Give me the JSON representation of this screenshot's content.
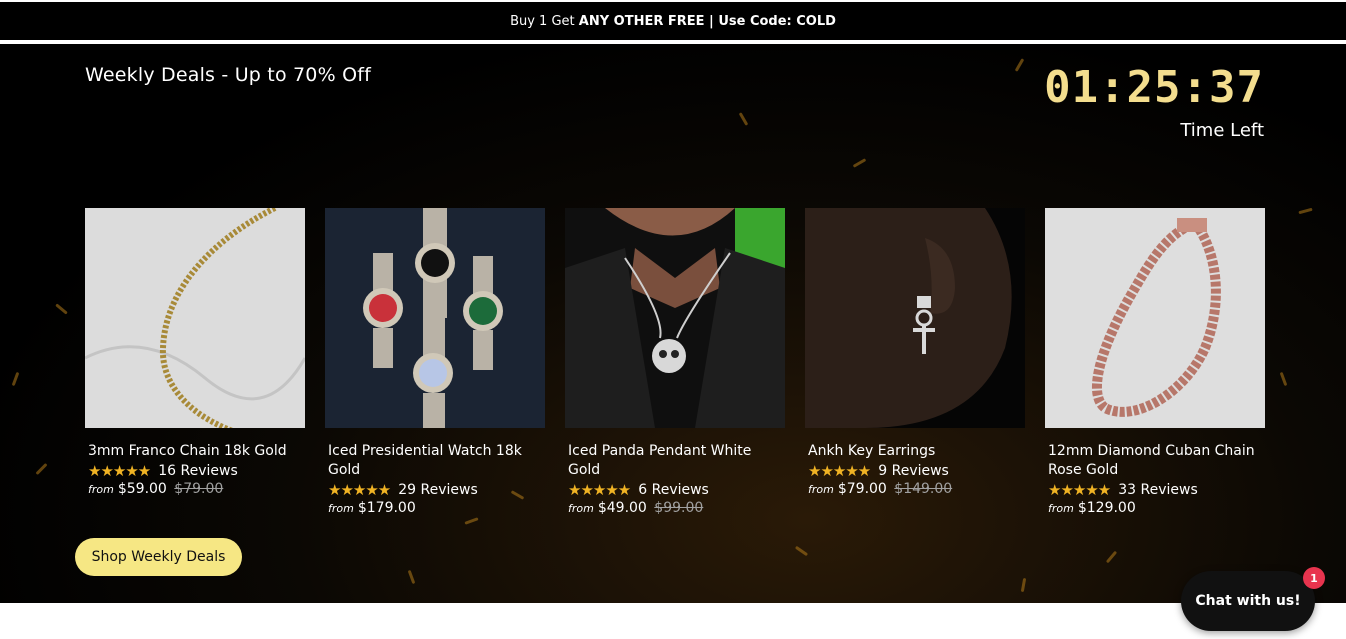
{
  "announcement": {
    "prefix": "Buy 1 Get",
    "highlight": "ANY OTHER FREE | Use Code: COLD"
  },
  "hero": {
    "title": "Weekly Deals - Up to 70% Off",
    "timer": "01:25:37",
    "timer_label": "Time Left"
  },
  "products": [
    {
      "name": "3mm Franco Chain 18k Gold",
      "stars": "★★★★★",
      "reviews": "16 Reviews",
      "from": "from",
      "price": "$59.00",
      "old_price": "$79.00",
      "image_icon": "gold-chain-image"
    },
    {
      "name": "Iced Presidential Watch 18k Gold",
      "stars": "★★★★★",
      "reviews": "29 Reviews",
      "from": "from",
      "price": "$179.00",
      "old_price": "",
      "image_icon": "watches-image"
    },
    {
      "name": "Iced Panda Pendant White Gold",
      "stars": "★★★★★",
      "reviews": "6 Reviews",
      "from": "from",
      "price": "$49.00",
      "old_price": "$99.00",
      "image_icon": "pendant-image"
    },
    {
      "name": "Ankh Key Earrings",
      "stars": "★★★★★",
      "reviews": "9 Reviews",
      "from": "from",
      "price": "$79.00",
      "old_price": "$149.00",
      "image_icon": "earring-image"
    },
    {
      "name": "12mm Diamond Cuban Chain Rose Gold",
      "stars": "★★★★★",
      "reviews": "33 Reviews",
      "from": "from",
      "price": "$129.00",
      "old_price": "",
      "image_icon": "rose-chain-image"
    }
  ],
  "shop_button": "Shop Weekly Deals",
  "chat": {
    "label": "Chat with us!",
    "badge": "1"
  },
  "colors": {
    "accent_gold": "#f3dd8e",
    "star": "#f0b324",
    "button": "#f6e784",
    "badge": "#e8344e"
  }
}
